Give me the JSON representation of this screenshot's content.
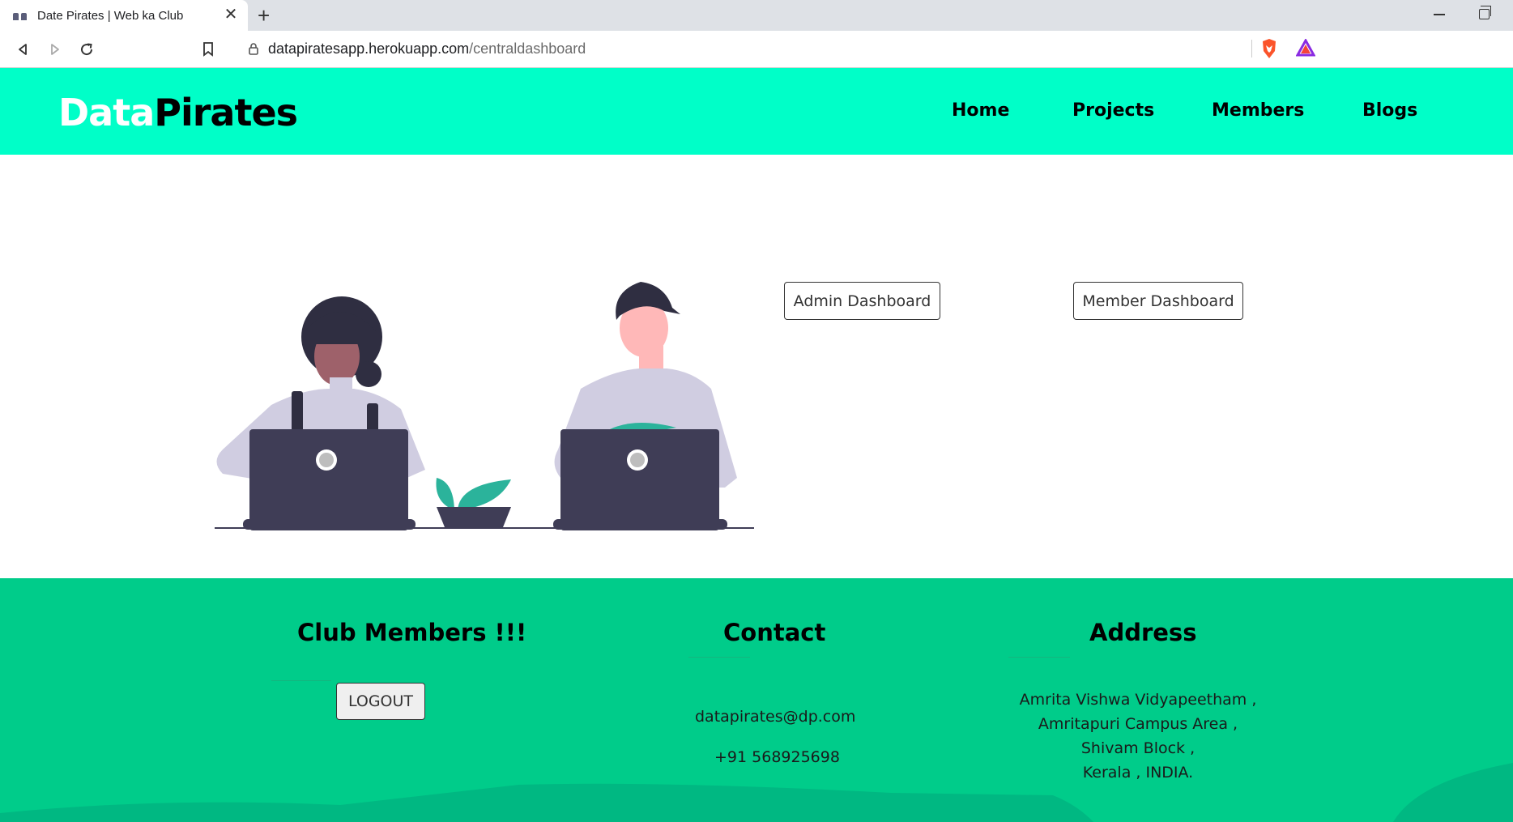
{
  "browser": {
    "tab_title": "Date Pirates | Web ka Club",
    "url_host": "datapiratesapp.herokuapp.com",
    "url_path": "/centraldashboard"
  },
  "header": {
    "logo_part1": "Data",
    "logo_part2": "Pirates",
    "nav": [
      "Home",
      "Projects",
      "Members",
      "Blogs"
    ]
  },
  "main": {
    "admin_button": "Admin Dashboard",
    "member_button": "Member Dashboard"
  },
  "footer": {
    "members_heading": "Club Members !!!",
    "logout_button": "LOGOUT",
    "contact_heading": "Contact",
    "email": "datapirates@dp.com",
    "phone": "+91 568925698",
    "address_heading": "Address",
    "address_lines": [
      "Amrita Vishwa Vidyapeetham ,",
      "Amritapuri Campus Area ,",
      "Shivam Block ,",
      "Kerala , INDIA."
    ]
  },
  "colors": {
    "header_bg": "#00ffc8",
    "footer_bg": "#00cc8a",
    "laptop": "#3f3d56",
    "plant": "#2bb39b"
  }
}
